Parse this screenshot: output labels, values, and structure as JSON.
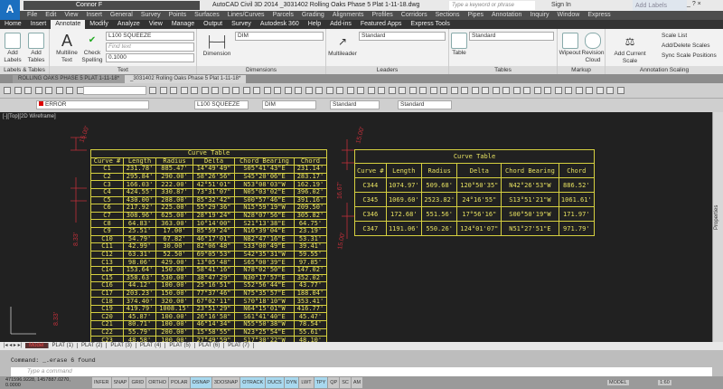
{
  "title_bar": {
    "app_logo": "A",
    "workspace": "Connor F",
    "title": "AutoCAD Civil 3D 2014   _3031402 Rolling Oaks Phase 5 Plat 1-11-18.dwg",
    "search_placeholder": "Type a keyword or phrase",
    "sign_in": "Sign In",
    "floating_text": "Add Labels",
    "window_controls": "_ ? ×"
  },
  "menu": [
    "File",
    "Edit",
    "View",
    "Insert",
    "General",
    "Survey",
    "Points",
    "Surfaces",
    "Lines/Curves",
    "Parcels",
    "Grading",
    "Alignments",
    "Profiles",
    "Corridors",
    "Sections",
    "Pipes",
    "Annotation",
    "Inquiry",
    "Window",
    "Express"
  ],
  "ribbon_tabs": [
    {
      "label": "Home"
    },
    {
      "label": "Insert"
    },
    {
      "label": "Annotate",
      "active": true
    },
    {
      "label": "Modify"
    },
    {
      "label": "Analyze"
    },
    {
      "label": "View"
    },
    {
      "label": "Manage"
    },
    {
      "label": "Output"
    },
    {
      "label": "Survey"
    },
    {
      "label": "Autodesk 360"
    },
    {
      "label": "Help"
    },
    {
      "label": "Add-ins"
    },
    {
      "label": "Featured Apps"
    },
    {
      "label": "Express Tools"
    }
  ],
  "ribbon": {
    "labels_tables": {
      "title": "Labels & Tables",
      "add_labels": "Add Labels",
      "add_tables": "Add Tables"
    },
    "text": {
      "title": "Text",
      "multiline": "Multiline Text",
      "check_spelling": "Check Spelling",
      "style": "L100 SQUEEZE",
      "find_placeholder": "Find text",
      "height": "0.1000"
    },
    "dimensions": {
      "title": "Dimensions",
      "dimension": "Dimension",
      "style": "DIM"
    },
    "leaders": {
      "title": "Leaders",
      "multileader": "Multileader",
      "style": "Standard"
    },
    "tables": {
      "title": "Tables",
      "table": "Table",
      "style": "Standard"
    },
    "markup": {
      "title": "Markup",
      "wipeout": "Wipeout",
      "revision_cloud": "Revision Cloud"
    },
    "annotation_scaling": {
      "title": "Annotation Scaling",
      "add_current_scale": "Add Current Scale",
      "scale_list": "Scale List",
      "add_delete_scales": "Add/Delete Scales",
      "sync_scale_positions": "Sync Scale Positions"
    }
  },
  "file_tabs": [
    {
      "label": "ROLLING OAKS PHASE 5 PLAT 1-11-18*"
    },
    {
      "label": "_3031402 Rolling Oaks Phase 5 Plat 1-11-18*",
      "active": true
    }
  ],
  "toolbars": {
    "layer": "ERROR",
    "text_style": "L100 SQUEEZE",
    "dim_style": "DIM",
    "table_style": "Standard",
    "mleader_style": "Standard"
  },
  "viewport_label": "[-][Top][2D Wireframe]",
  "dimension_labels": [
    "15.00'",
    "15.00'",
    "16.67'",
    "15.00'",
    "8.33'",
    "8.33'"
  ],
  "curve_table_left": {
    "title": "Curve Table",
    "headers": [
      "Curve #",
      "Length",
      "Radius",
      "Delta",
      "Chord Bearing",
      "Chord"
    ],
    "rows": [
      [
        "C1",
        "231.78'",
        "885.47'",
        "14°49'49\"",
        "S05°41'43\"E",
        "231.14'"
      ],
      [
        "C2",
        "295.84'",
        "290.00'",
        "58°26'56\"",
        "S45°20'06\"E",
        "283.17'"
      ],
      [
        "C3",
        "166.03'",
        "222.00'",
        "42°51'01\"",
        "N53°08'03\"W",
        "162.19'"
      ],
      [
        "C4",
        "424.55'",
        "330.87'",
        "73°31'07\"",
        "N05°03'02\"E",
        "396.02'"
      ],
      [
        "C5",
        "430.00'",
        "288.00'",
        "85°32'42\"",
        "S00°57'46\"E",
        "391.16'"
      ],
      [
        "C6",
        "217.92'",
        "225.00'",
        "55°29'36\"",
        "N15°59'19\"W",
        "209.50'"
      ],
      [
        "C7",
        "308.96'",
        "625.00'",
        "28°19'24\"",
        "N28°07'56\"E",
        "305.82'"
      ],
      [
        "C8",
        "64.83'",
        "363.00'",
        "10°14'00\"",
        "S21°13'38\"E",
        "64.75'"
      ],
      [
        "C9",
        "25.51'",
        "17.00'",
        "85°59'24\"",
        "N16°39'04\"E",
        "23.19'"
      ],
      [
        "C10",
        "54.79'",
        "67.82'",
        "46°17'01\"",
        "N82°47'16\"E",
        "53.31'"
      ],
      [
        "C11",
        "42.99'",
        "30.00'",
        "82°06'48\"",
        "S33°00'49\"E",
        "39.41'"
      ],
      [
        "C12",
        "63.31'",
        "52.50'",
        "69°05'53\"",
        "S42°35'31\"W",
        "59.55'"
      ],
      [
        "C13",
        "98.06'",
        "429.00'",
        "13°05'48\"",
        "S65°00'39\"E",
        "97.85'"
      ],
      [
        "C14",
        "153.64'",
        "150.00'",
        "58°41'16\"",
        "N78°02'50\"E",
        "147.02'"
      ],
      [
        "C15",
        "358.63'",
        "530.00'",
        "38°47'29\"",
        "N30°17'57\"E",
        "352.02'"
      ],
      [
        "C16",
        "44.12'",
        "100.00'",
        "25°16'51\"",
        "S52°56'44\"E",
        "43.77'"
      ],
      [
        "C17",
        "203.23'",
        "150.00'",
        "77°37'46\"",
        "N75°35'57\"E",
        "188.04'"
      ],
      [
        "C18",
        "374.40'",
        "320.00'",
        "67°02'11\"",
        "S70°18'10\"W",
        "353.41'"
      ],
      [
        "C19",
        "419.79'",
        "1008.15'",
        "23°51'29\"",
        "N64°15'01\"W",
        "416.77'"
      ],
      [
        "C20",
        "45.87'",
        "100.00'",
        "26°16'58\"",
        "S61°41'40\"E",
        "45.47'"
      ],
      [
        "C21",
        "80.71'",
        "100.00'",
        "46°14'34\"",
        "N55°50'38\"W",
        "78.54'"
      ],
      [
        "C22",
        "55.79'",
        "200.00'",
        "15°58'55\"",
        "N23°25'54\"E",
        "55.61'"
      ],
      [
        "C23",
        "48.58'",
        "100.00'",
        "27°49'59\"",
        "S17°30'22\"W",
        "48.10'"
      ],
      [
        "C24",
        "12.20'",
        "100.00'",
        "6°59'23\"",
        "S24°35'01\"W",
        "12.19'"
      ]
    ]
  },
  "curve_table_right": {
    "title": "Curve Table",
    "headers": [
      "Curve #",
      "Length",
      "Radius",
      "Delta",
      "Chord Bearing",
      "Chord"
    ],
    "rows": [
      [
        "C344",
        "1074.97'",
        "509.68'",
        "120°50'35\"",
        "N42°26'53\"W",
        "886.52'"
      ],
      [
        "C345",
        "1069.60'",
        "2523.82'",
        "24°16'55\"",
        "S13°51'21\"W",
        "1061.61'"
      ],
      [
        "C346",
        "172.68'",
        "551.56'",
        "17°56'16\"",
        "S00°50'19\"W",
        "171.97'"
      ],
      [
        "C347",
        "1191.06'",
        "550.26'",
        "124°01'07\"",
        "N51°27'51\"E",
        "971.79'"
      ]
    ]
  },
  "properties_palette": "Properties",
  "layout_tabs": [
    {
      "label": "Model",
      "active": true
    },
    {
      "label": "PLAT (1)"
    },
    {
      "label": "PLAT (2)"
    },
    {
      "label": "PLAT (3)"
    },
    {
      "label": "PLAT (4)"
    },
    {
      "label": "PLAT (5)"
    },
    {
      "label": "PLAT (6)"
    },
    {
      "label": "PLAT (7)"
    }
  ],
  "command": {
    "history": "Command: _.erase 6 found",
    "placeholder": "Type a command"
  },
  "status": {
    "coords": "471596.9228, 1457887.0270, 0.0000",
    "toggles": [
      {
        "label": "INFER",
        "on": false
      },
      {
        "label": "SNAP",
        "on": false
      },
      {
        "label": "GRID",
        "on": false
      },
      {
        "label": "ORTHO",
        "on": false
      },
      {
        "label": "POLAR",
        "on": false
      },
      {
        "label": "OSNAP",
        "on": true
      },
      {
        "label": "3DOSNAP",
        "on": false
      },
      {
        "label": "OTRACK",
        "on": true
      },
      {
        "label": "DUCS",
        "on": true
      },
      {
        "label": "DYN",
        "on": true
      },
      {
        "label": "LWT",
        "on": false
      },
      {
        "label": "TPY",
        "on": true
      },
      {
        "label": "QP",
        "on": false
      },
      {
        "label": "SC",
        "on": false
      },
      {
        "label": "AM",
        "on": false
      }
    ],
    "model": "MODEL",
    "scale": "1:60"
  },
  "colors": {
    "drawing_bg": "#212121",
    "table_yellow": "#e6e060",
    "dimension_red": "#c0303a",
    "ribbon_bg": "#f2f2f2",
    "toggle_on": "#a8d8ee"
  }
}
